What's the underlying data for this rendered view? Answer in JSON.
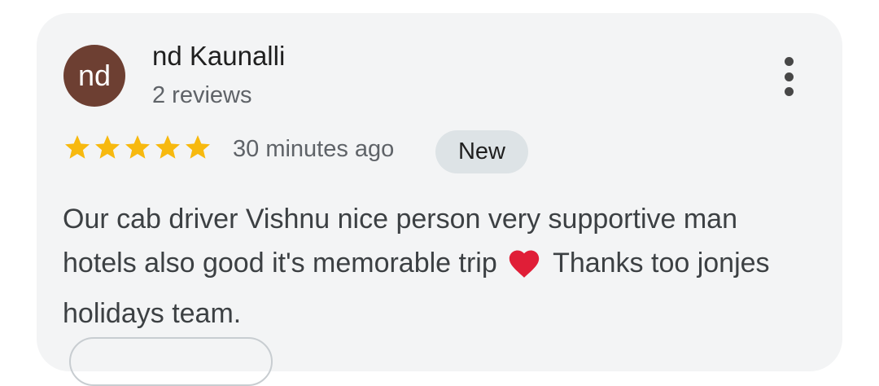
{
  "review": {
    "author": {
      "initials": "nd",
      "name": "nd Kaunalli",
      "review_count": "2 reviews"
    },
    "rating": 5,
    "rating_max": 5,
    "timestamp": "30 minutes ago",
    "badge": "New",
    "text_part1": "Our cab driver Vishnu nice person very supportive man hotels also good it's memorable trip",
    "text_part2": "Thanks too jonjes holidays team.",
    "icons": {
      "more": "more-vertical-icon",
      "star": "star-icon",
      "heart": "heart-icon"
    }
  },
  "colors": {
    "avatar_bg": "#6d3f32",
    "star": "#f7b90f",
    "heart": "#e01e37",
    "badge_bg": "#dde3e6",
    "card_bg": "#f3f4f5"
  }
}
